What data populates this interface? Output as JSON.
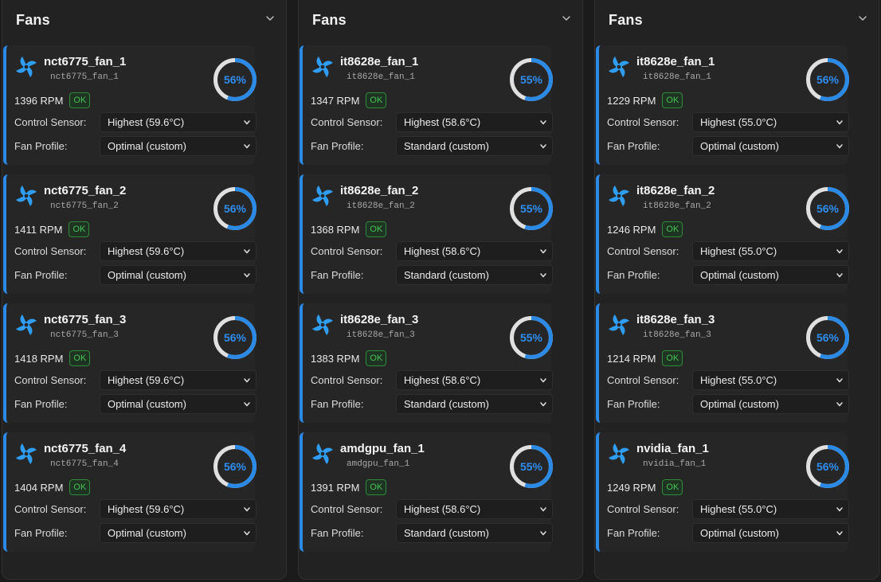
{
  "panels": [
    {
      "title": "Fans",
      "fans": [
        {
          "name": "nct6775_fan_1",
          "id": "nct6775_fan_1",
          "rpm": "1396 RPM",
          "status": "OK",
          "percent": 56,
          "percent_label": "56%",
          "control_sensor": "Highest (59.6°C)",
          "fan_profile": "Optimal (custom)"
        },
        {
          "name": "nct6775_fan_2",
          "id": "nct6775_fan_2",
          "rpm": "1411 RPM",
          "status": "OK",
          "percent": 56,
          "percent_label": "56%",
          "control_sensor": "Highest (59.6°C)",
          "fan_profile": "Optimal (custom)"
        },
        {
          "name": "nct6775_fan_3",
          "id": "nct6775_fan_3",
          "rpm": "1418 RPM",
          "status": "OK",
          "percent": 56,
          "percent_label": "56%",
          "control_sensor": "Highest (59.6°C)",
          "fan_profile": "Optimal (custom)"
        },
        {
          "name": "nct6775_fan_4",
          "id": "nct6775_fan_4",
          "rpm": "1404 RPM",
          "status": "OK",
          "percent": 56,
          "percent_label": "56%",
          "control_sensor": "Highest (59.6°C)",
          "fan_profile": "Optimal (custom)"
        }
      ]
    },
    {
      "title": "Fans",
      "fans": [
        {
          "name": "it8628e_fan_1",
          "id": "it8628e_fan_1",
          "rpm": "1347 RPM",
          "status": "OK",
          "percent": 55,
          "percent_label": "55%",
          "control_sensor": "Highest (58.6°C)",
          "fan_profile": "Standard (custom)"
        },
        {
          "name": "it8628e_fan_2",
          "id": "it8628e_fan_2",
          "rpm": "1368 RPM",
          "status": "OK",
          "percent": 55,
          "percent_label": "55%",
          "control_sensor": "Highest (58.6°C)",
          "fan_profile": "Standard (custom)"
        },
        {
          "name": "it8628e_fan_3",
          "id": "it8628e_fan_3",
          "rpm": "1383 RPM",
          "status": "OK",
          "percent": 55,
          "percent_label": "55%",
          "control_sensor": "Highest (58.6°C)",
          "fan_profile": "Standard (custom)"
        },
        {
          "name": "amdgpu_fan_1",
          "id": "amdgpu_fan_1",
          "rpm": "1391 RPM",
          "status": "OK",
          "percent": 55,
          "percent_label": "55%",
          "control_sensor": "Highest (58.6°C)",
          "fan_profile": "Standard (custom)"
        }
      ]
    },
    {
      "title": "Fans",
      "fans": [
        {
          "name": "it8628e_fan_1",
          "id": "it8628e_fan_1",
          "rpm": "1229 RPM",
          "status": "OK",
          "percent": 56,
          "percent_label": "56%",
          "control_sensor": "Highest (55.0°C)",
          "fan_profile": "Optimal (custom)"
        },
        {
          "name": "it8628e_fan_2",
          "id": "it8628e_fan_2",
          "rpm": "1246 RPM",
          "status": "OK",
          "percent": 56,
          "percent_label": "56%",
          "control_sensor": "Highest (55.0°C)",
          "fan_profile": "Optimal (custom)"
        },
        {
          "name": "it8628e_fan_3",
          "id": "it8628e_fan_3",
          "rpm": "1214 RPM",
          "status": "OK",
          "percent": 56,
          "percent_label": "56%",
          "control_sensor": "Highest (55.0°C)",
          "fan_profile": "Optimal (custom)"
        },
        {
          "name": "nvidia_fan_1",
          "id": "nvidia_fan_1",
          "rpm": "1249 RPM",
          "status": "OK",
          "percent": 56,
          "percent_label": "56%",
          "control_sensor": "Highest (55.0°C)",
          "fan_profile": "Optimal (custom)"
        }
      ]
    }
  ],
  "labels": {
    "control_sensor": "Control Sensor:",
    "fan_profile": "Fan Profile:"
  },
  "icons": {
    "fan": "fan-icon",
    "collapse": "chevron-down-icon",
    "dropdown": "chevron-down-icon"
  },
  "colors": {
    "accent": "#2a8ae6",
    "gauge_track": "#e0e0e0",
    "ok_text": "#46c255"
  }
}
